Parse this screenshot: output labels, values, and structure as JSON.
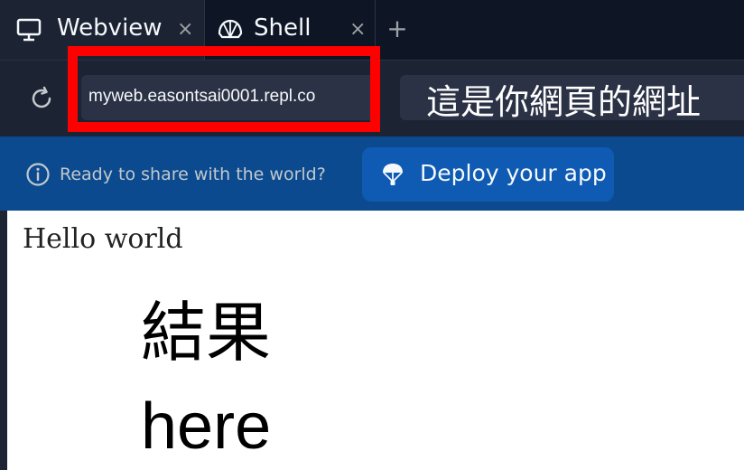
{
  "tabs": [
    {
      "label": "Webview",
      "icon": "monitor-icon",
      "active": true
    },
    {
      "label": "Shell",
      "icon": "shell-icon",
      "active": false
    }
  ],
  "tab_close_glyph": "×",
  "new_tab_glyph": "+",
  "url_bar": {
    "value": "myweb.easontsai0001.repl.co"
  },
  "annotation": {
    "text": "這是你網頁的網址",
    "highlight_color": "#ff0000"
  },
  "banner": {
    "message": "Ready to share with the world?",
    "deploy_label": "Deploy your app",
    "background": "#0b4a8f"
  },
  "page": {
    "hello": "Hello world",
    "result_line1": "結果",
    "result_line2": "here"
  }
}
